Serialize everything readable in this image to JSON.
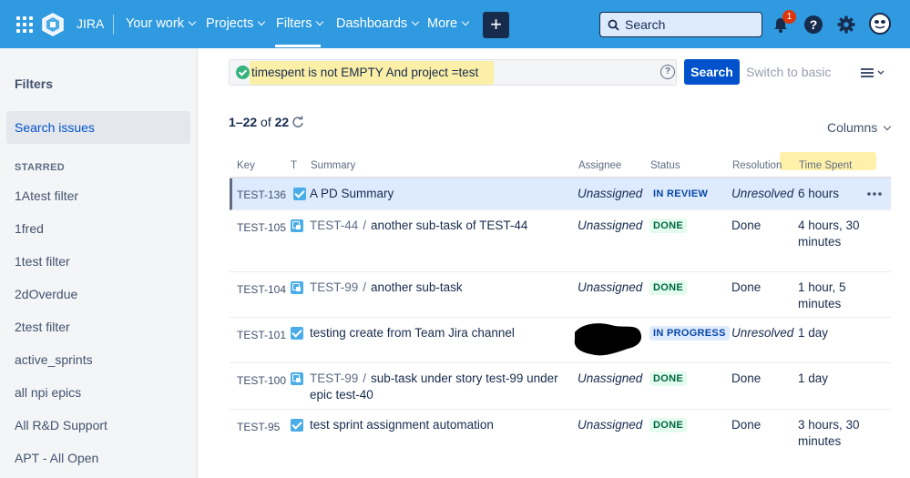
{
  "topbar": {
    "app_name": "JIRA",
    "nav": [
      "Your work",
      "Projects",
      "Filters",
      "Dashboards",
      "More"
    ],
    "active_nav": "Filters",
    "create_label": "+",
    "search_placeholder": "Search",
    "notification_count": "1",
    "help_label": "?"
  },
  "sidebar": {
    "title": "Filters",
    "active_item": "Search issues",
    "starred_title": "STARRED",
    "items": [
      "1Atest filter",
      "1fred",
      "1test filter",
      "2dOverdue",
      "2test filter",
      "active_sprints",
      "all npi epics",
      "All R&D Support",
      "APT - All Open"
    ]
  },
  "query": {
    "jql": "timespent is not EMPTY And project =test",
    "search_button": "Search",
    "switch_label": "Switch to basic"
  },
  "results": {
    "range": "1–22",
    "of_label": "of",
    "total": "22",
    "columns_label": "Columns"
  },
  "table": {
    "headers": {
      "key": "Key",
      "type": "T",
      "summary": "Summary",
      "assignee": "Assignee",
      "status": "Status",
      "resolution": "Resolution",
      "time_spent": "Time Spent"
    },
    "rows": [
      {
        "key": "TEST-136",
        "type": "task",
        "parent": "",
        "summary": "A PD Summary",
        "assignee": "Unassigned",
        "status": "IN REVIEW",
        "resolution": "Unresolved",
        "time_spent": "6 hours"
      },
      {
        "key": "TEST-105",
        "type": "subtask",
        "parent": "TEST-44",
        "summary": "another sub-task of TEST-44",
        "assignee": "Unassigned",
        "status": "DONE",
        "resolution": "Done",
        "time_spent": "4 hours, 30 minutes"
      },
      {
        "key": "TEST-104",
        "type": "subtask",
        "parent": "TEST-99",
        "summary": "another sub-task",
        "assignee": "Unassigned",
        "status": "DONE",
        "resolution": "Done",
        "time_spent": "1 hour, 5 minutes"
      },
      {
        "key": "TEST-101",
        "type": "task",
        "parent": "",
        "summary": "testing create from Team Jira channel",
        "assignee": "",
        "status": "IN PROGRESS",
        "resolution": "Unresolved",
        "time_spent": "1 day"
      },
      {
        "key": "TEST-100",
        "type": "subtask",
        "parent": "TEST-99",
        "summary": "sub-task under story test-99 under epic test-40",
        "assignee": "Unassigned",
        "status": "DONE",
        "resolution": "Done",
        "time_spent": "1 day"
      },
      {
        "key": "TEST-95",
        "type": "task",
        "parent": "",
        "summary": "test sprint assignment automation",
        "assignee": "Unassigned",
        "status": "DONE",
        "resolution": "Done",
        "time_spent": "3 hours, 30 minutes"
      }
    ]
  },
  "colors": {
    "topbar": "#2f9ae0",
    "primary": "#0052cc",
    "highlight": "#ffec8c"
  },
  "icons": [
    "app-grid-icon",
    "jira-logo-icon",
    "search-icon",
    "bell-icon",
    "help-icon",
    "gear-icon",
    "avatar",
    "refresh-icon",
    "list-view-icon",
    "more-icon"
  ]
}
